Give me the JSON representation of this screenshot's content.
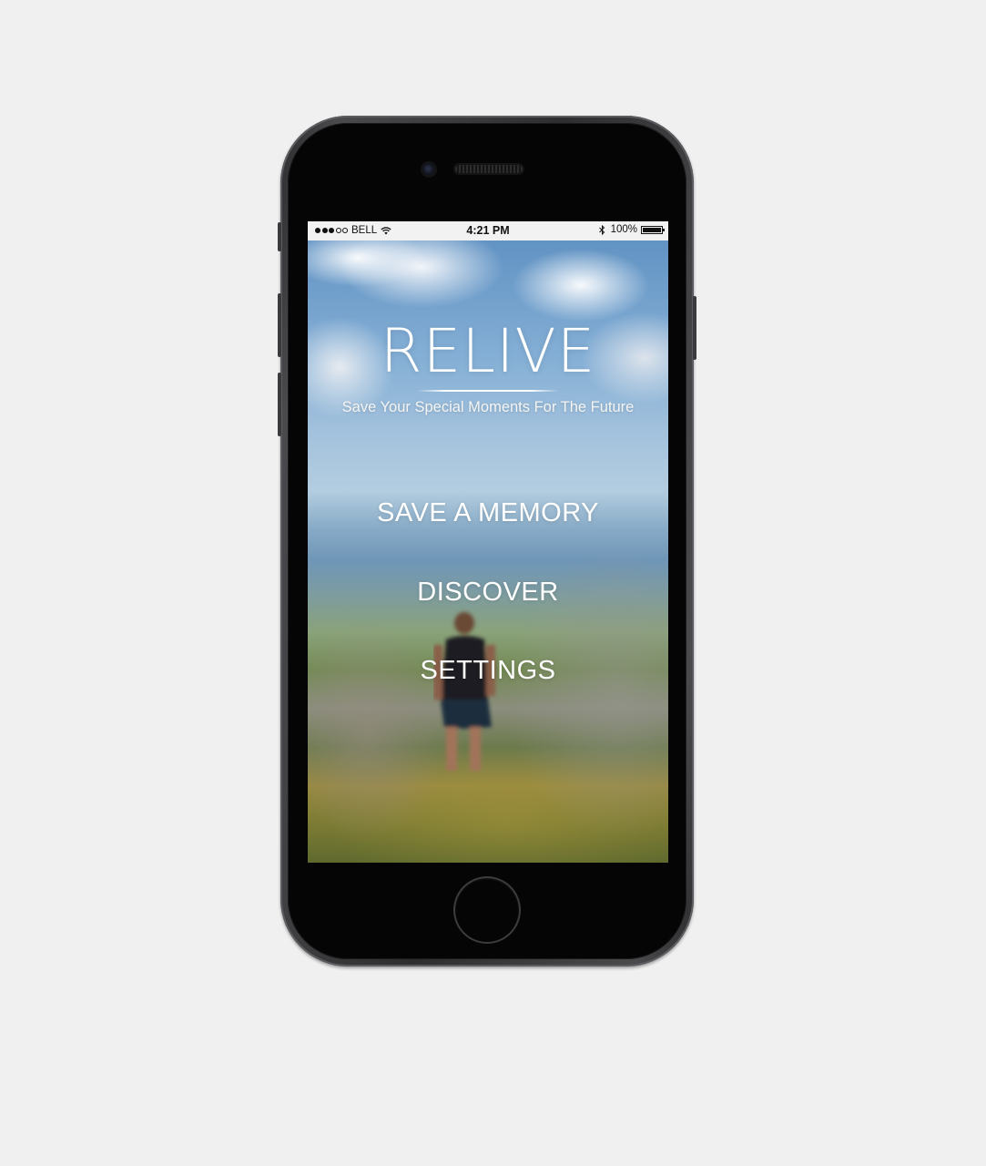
{
  "status_bar": {
    "signal_dots": [
      true,
      true,
      true,
      false,
      false
    ],
    "carrier": "BELL",
    "time": "4:21 PM",
    "battery_percent": "100%",
    "battery_level": 1.0
  },
  "app": {
    "title": "RELIVE",
    "tagline": "Save Your Special Moments For The Future"
  },
  "menu": {
    "items": [
      {
        "label": "SAVE A MEMORY"
      },
      {
        "label": "DISCOVER"
      },
      {
        "label": "SETTINGS"
      }
    ]
  },
  "icons": {
    "wifi": "wifi-icon",
    "bluetooth": "bluetooth-icon",
    "battery": "battery-icon"
  },
  "colors": {
    "background": "#f0f0f0",
    "phone_body": "#2e2e30",
    "status_bar_bg": "#f2f2f2",
    "menu_text": "#ffffff"
  }
}
